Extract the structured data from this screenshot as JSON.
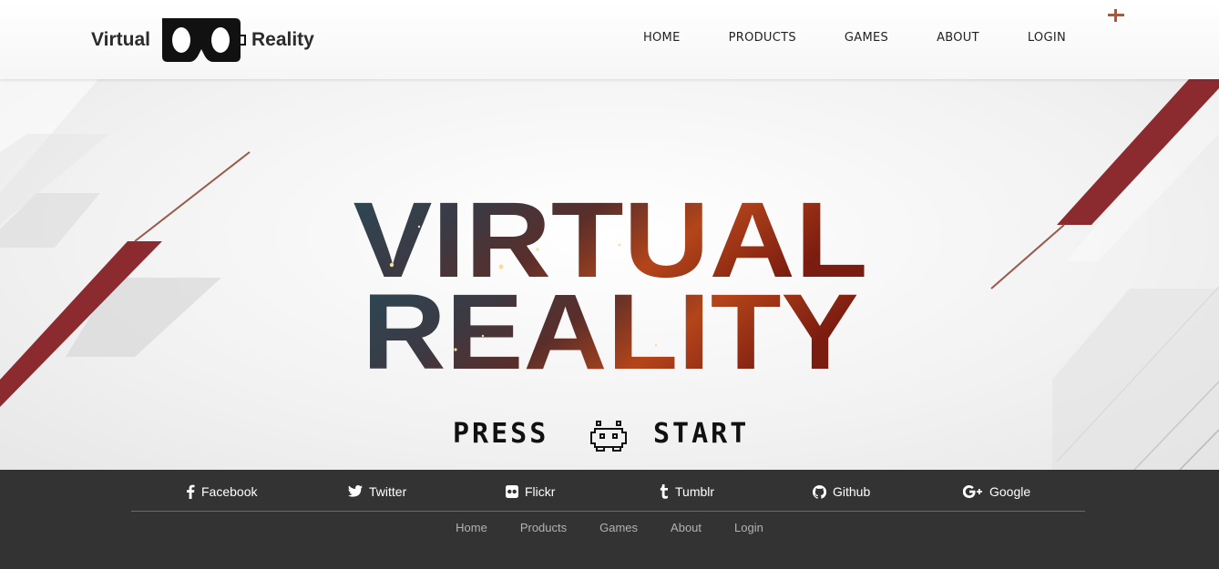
{
  "brand": {
    "left_text": "Virtual",
    "right_text": "Reality",
    "icon": "vr-headset-icon"
  },
  "nav": {
    "items": [
      {
        "label": "HOME"
      },
      {
        "label": "PRODUCTS"
      },
      {
        "label": "GAMES"
      },
      {
        "label": "ABOUT"
      },
      {
        "label": "LOGIN"
      }
    ]
  },
  "corner_icon": "plus-icon",
  "hero": {
    "title_line1": "VIRTUAL",
    "title_line2": "REALITY",
    "press_word": "PRESS",
    "start_word": "START",
    "invader_icon": "space-invader-icon"
  },
  "social": {
    "items": [
      {
        "label": "Facebook",
        "icon": "facebook-icon"
      },
      {
        "label": "Twitter",
        "icon": "twitter-icon"
      },
      {
        "label": "Flickr",
        "icon": "flickr-icon"
      },
      {
        "label": "Tumblr",
        "icon": "tumblr-icon"
      },
      {
        "label": "Github",
        "icon": "github-icon"
      },
      {
        "label": "Google",
        "icon": "google-plus-icon"
      }
    ]
  },
  "footer": {
    "links": [
      {
        "label": "Home"
      },
      {
        "label": "Products"
      },
      {
        "label": "Games"
      },
      {
        "label": "About"
      },
      {
        "label": "Login"
      }
    ]
  },
  "colors": {
    "accent_red": "#8b2b2f",
    "footer_bg": "#333333",
    "plus_orange": "#c0502a"
  }
}
